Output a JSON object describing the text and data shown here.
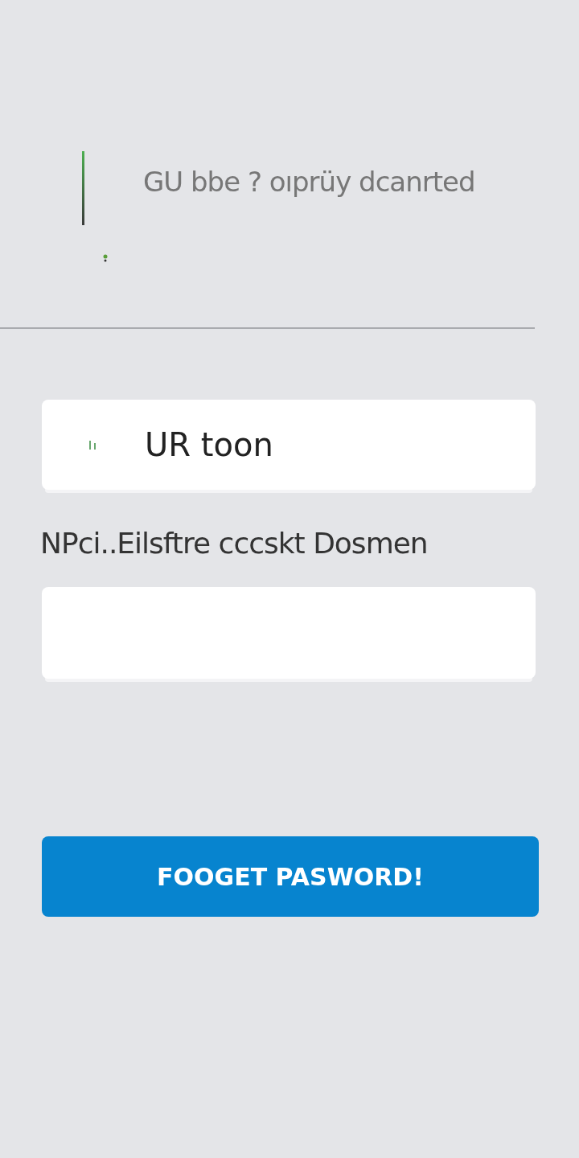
{
  "header": {
    "title": "GU bbe ? oıprüy dcanrted"
  },
  "username": {
    "value": "UR toon"
  },
  "password": {
    "label": "NPci..Eilsftre cccskt Dosmen"
  },
  "button": {
    "label": "FOOGET PASWORD!"
  }
}
